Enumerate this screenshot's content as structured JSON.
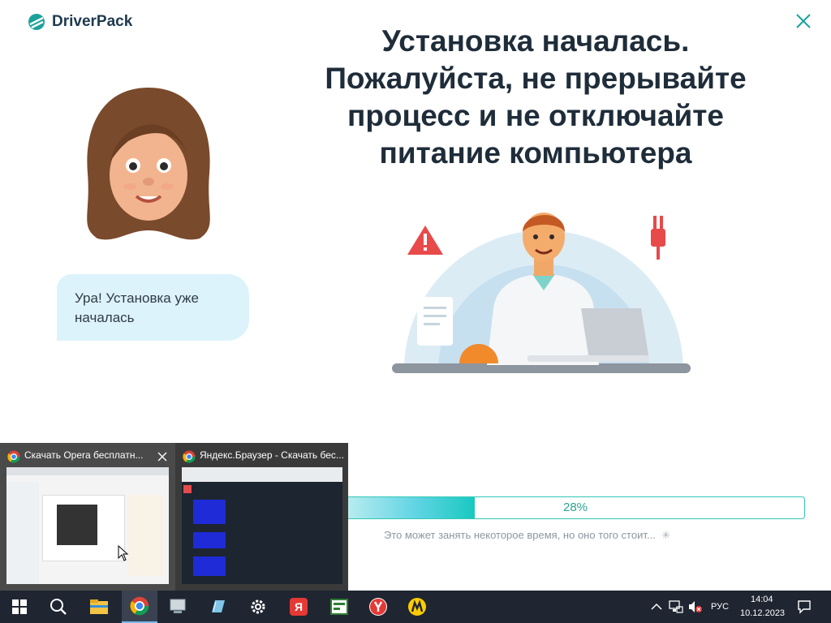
{
  "app": {
    "name": "DriverPack"
  },
  "headline": [
    "Установка началась.",
    "Пожалуйста, не прерывайте",
    "процесс и не отключайте",
    "питание компьютера"
  ],
  "assistant": {
    "message": "Ура! Установка уже началась"
  },
  "progress": {
    "value": 0.28,
    "label": "28%",
    "hint": "Это может занять некоторое время, но оно того стоит..."
  },
  "taskbar_preview": [
    {
      "title": "Скачать Opera бесплатн...",
      "icon": "chrome-icon"
    },
    {
      "title": "Яндекс.Браузер - Скачать бес...",
      "icon": "chrome-icon"
    }
  ],
  "taskbar": {
    "language": "РУС",
    "time": "14:04",
    "date": "10.12.2023",
    "items": [
      "start-icon",
      "search-icon",
      "file-explorer-icon",
      "chrome-icon",
      "remote-desktop-icon",
      "notes-icon",
      "settings-icon",
      "yandex-icon",
      "app-icon",
      "yandex-browser-icon",
      "yandex-market-icon"
    ]
  },
  "colors": {
    "accent": "#19c9c0",
    "headline": "#1f2d3a",
    "bubble": "#dcf3fb",
    "taskbar": "#1f2631"
  }
}
